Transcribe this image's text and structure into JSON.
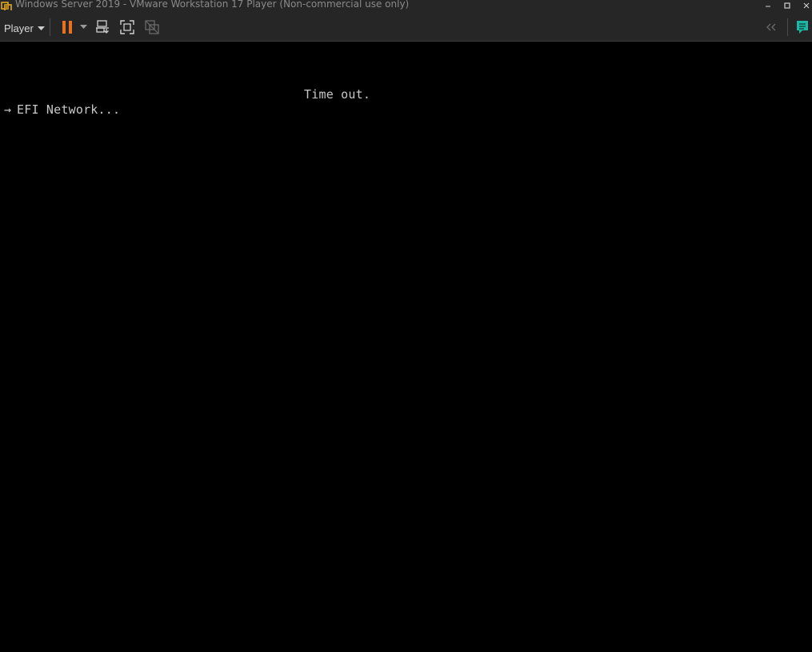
{
  "window": {
    "title": "Windows Server 2019 - VMware Workstation 17 Player (Non-commercial use only)"
  },
  "toolbar": {
    "player_label": "Player"
  },
  "icons": {
    "app": "vmware-player-icon",
    "minimize": "minimize-icon",
    "maximize": "maximize-icon",
    "close": "close-icon",
    "pause": "pause-icon",
    "dropdown": "chevron-down-icon",
    "send_cad": "ctrl-alt-del-icon",
    "fullscreen": "fullscreen-icon",
    "unity": "unity-icon",
    "collapse": "double-chevron-left-icon",
    "notes": "message-log-icon"
  },
  "colors": {
    "titlebar_bg": "#262626",
    "pause_accent": "#e8701f",
    "notes_accent": "#1fb5a5",
    "console_text": "#c8c8c8"
  },
  "console": {
    "timeout_text": "Time out.",
    "boot_arrow": "→",
    "boot_entry": "EFI Network..."
  }
}
